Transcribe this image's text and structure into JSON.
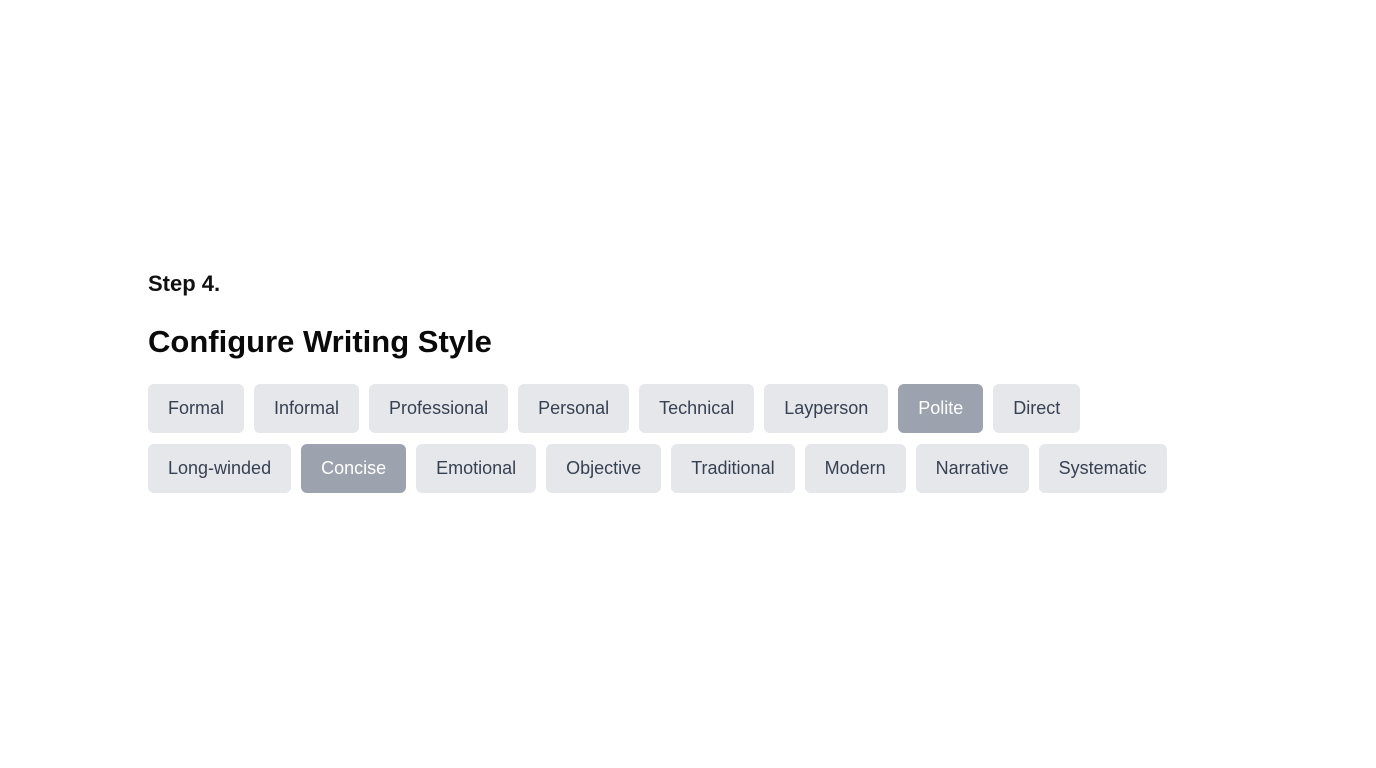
{
  "step": {
    "label": "Step 4."
  },
  "title": "Configure Writing Style",
  "colors": {
    "chip_bg": "#e5e7eb",
    "chip_text": "#374151",
    "chip_selected_bg": "#9ca3af",
    "chip_selected_text": "#ffffff"
  },
  "options": [
    {
      "label": "Formal",
      "selected": false
    },
    {
      "label": "Informal",
      "selected": false
    },
    {
      "label": "Professional",
      "selected": false
    },
    {
      "label": "Personal",
      "selected": false
    },
    {
      "label": "Technical",
      "selected": false
    },
    {
      "label": "Layperson",
      "selected": false
    },
    {
      "label": "Polite",
      "selected": true
    },
    {
      "label": "Direct",
      "selected": false
    },
    {
      "label": "Long-winded",
      "selected": false
    },
    {
      "label": "Concise",
      "selected": true
    },
    {
      "label": "Emotional",
      "selected": false
    },
    {
      "label": "Objective",
      "selected": false
    },
    {
      "label": "Traditional",
      "selected": false
    },
    {
      "label": "Modern",
      "selected": false
    },
    {
      "label": "Narrative",
      "selected": false
    },
    {
      "label": "Systematic",
      "selected": false
    }
  ]
}
